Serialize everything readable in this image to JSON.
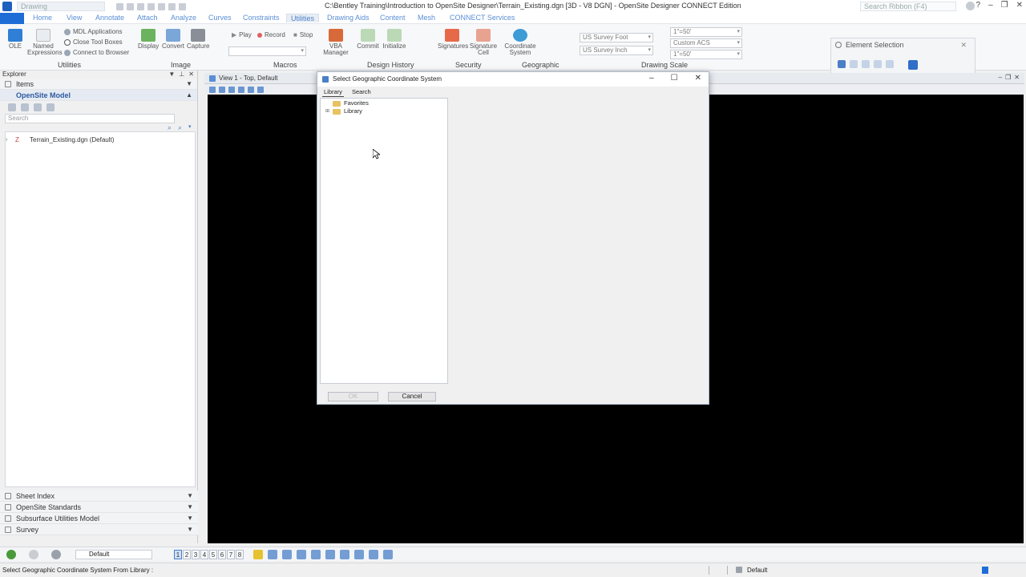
{
  "titlebar": {
    "qat_search": "Drawing",
    "title": "C:\\Bentley Training\\Introduction to OpenSite Designer\\Terrain_Existing.dgn [3D - V8 DGN] - OpenSite Designer CONNECT Edition",
    "search_placeholder": "Search Ribbon (F4)"
  },
  "tabs": [
    "Home",
    "View",
    "Annotate",
    "Attach",
    "Analyze",
    "Curves",
    "Constraints",
    "Utilities",
    "Drawing Aids",
    "Content",
    "Mesh",
    "CONNECT Services"
  ],
  "active_tab": "Utilities",
  "ribbon": {
    "groups": {
      "utilities": "Utilities",
      "image": "Image",
      "macros": "Macros",
      "design_history": "Design History",
      "security": "Security",
      "geographic": "Geographic",
      "drawing_scale": "Drawing Scale"
    },
    "buttons": {
      "ole": "OLE",
      "named_expressions": "Named Expressions",
      "mdl_applications": "MDL Applications",
      "close_tool_boxes": "Close Tool Boxes",
      "connect_to_browser": "Connect to Browser",
      "display": "Display",
      "convert": "Convert",
      "capture": "Capture",
      "play": "Play",
      "record": "Record",
      "stop": "Stop",
      "vba_manager": "VBA Manager",
      "commit": "Commit",
      "initialize": "Initialize",
      "signatures": "Signatures",
      "signature_cell": "Signature Cell",
      "coordinate_system": "Coordinate System"
    },
    "units": {
      "master": "US Survey Foot",
      "sub": "US Survey Inch",
      "scale1": "1\"=50'",
      "acs": "Custom ACS",
      "scale2": "1\"=50'"
    }
  },
  "element_selection": {
    "title": "Element Selection"
  },
  "explorer": {
    "title": "Explorer",
    "sections_top": [
      {
        "label": "Items",
        "active": false
      },
      {
        "label": "OpenSite Model",
        "active": true
      }
    ],
    "search_placeholder": "Search",
    "tree_item": "Terrain_Existing.dgn (Default)",
    "sections_bottom": [
      "Sheet Index",
      "OpenSite Standards",
      "Subsurface Utilities Model",
      "Survey"
    ]
  },
  "view": {
    "title": "View 1 - Top, Default"
  },
  "dialog": {
    "title": "Select Geographic Coordinate System",
    "tabs": [
      "Library",
      "Search"
    ],
    "active_tab": "Library",
    "tree": [
      "Favorites",
      "Library"
    ],
    "ok_label": "OK",
    "cancel_label": "Cancel"
  },
  "bottombar": {
    "level_combo": "Default",
    "views": [
      "1",
      "2",
      "3",
      "4",
      "5",
      "6",
      "7",
      "8"
    ],
    "active_view": "1"
  },
  "statusbar": {
    "message": "Select Geographic Coordinate System From Library :",
    "level": "Default"
  },
  "colors": {
    "accent": "#1e6dd6",
    "tab_text": "#5a8ed6",
    "viewport_bg": "#000000"
  }
}
